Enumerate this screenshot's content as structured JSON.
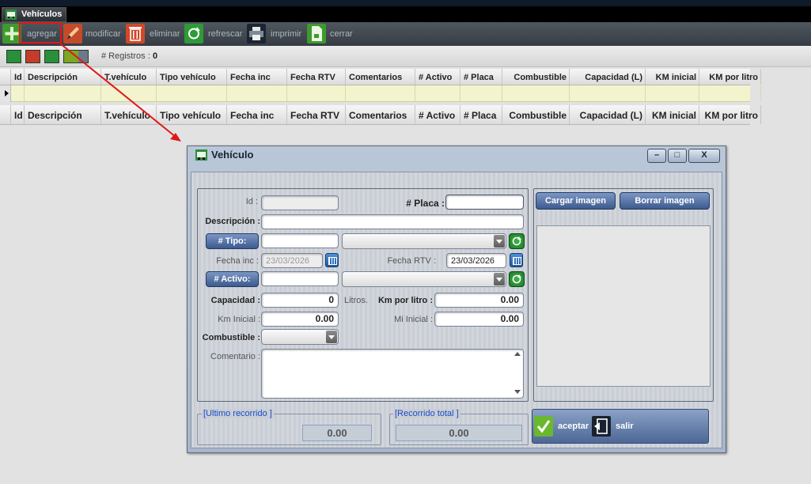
{
  "window": {
    "tab_title": "Vehículos"
  },
  "toolbar": {
    "add": "agregar",
    "modify": "modificar",
    "delete": "eliminar",
    "refresh": "refrescar",
    "print": "imprimir",
    "close": "cerrar"
  },
  "subbar": {
    "records_label": "# Registros :",
    "records_count": "0"
  },
  "grid_columns": [
    "Id",
    "Descripción",
    "T.vehículo",
    "Tipo vehículo",
    "Fecha inc",
    "Fecha RTV",
    "Comentarios",
    "# Activo",
    "# Placa",
    "Combustible",
    "Capacidad (L)",
    "KM inicial",
    "KM por litro"
  ],
  "dialog": {
    "title": "Vehículo",
    "min_btn": "–",
    "max_btn": "□",
    "close_btn": "X",
    "labels": {
      "id": "Id :",
      "placa": "# Placa :",
      "descripcion": "Descripción :",
      "tipo": "# Tipo:",
      "fecha_inc": "Fecha inc :",
      "fecha_rtv": "Fecha RTV :",
      "activo": "# Activo:",
      "capacidad": "Capacidad :",
      "litros": "Litros.",
      "km_por_litro": "Km por litro :",
      "km_inicial": "Km Inicial :",
      "mi_inicial": "Mi Inicial :",
      "combustible": "Combustible :",
      "comentario": "Comentario :"
    },
    "values": {
      "id": "",
      "placa": "",
      "descripcion": "",
      "tipo_code": "",
      "tipo_select": "",
      "fecha_inc": "23/03/2026",
      "fecha_rtv": "23/03/2026",
      "activo_code": "",
      "activo_select": "",
      "capacidad": "0",
      "km_por_litro": "0.00",
      "km_inicial": "0.00",
      "mi_inicial": "0.00",
      "combustible": "",
      "comentario": ""
    },
    "image_buttons": {
      "load": "Cargar imagen",
      "delete": "Borrar imagen"
    },
    "ultimo_recorrido": {
      "legend": "[Ultimo recorrido ]",
      "value": "0.00"
    },
    "recorrido_total": {
      "legend": "[Recorrido total ]",
      "value": "0.00"
    },
    "actions": {
      "accept": "aceptar",
      "exit": "salir"
    }
  },
  "colors": {
    "accent_red": "#e01818",
    "toolbar_bg": "#3f464d",
    "dialog_bg": "#b0bed0",
    "button_blue": "#4e6ea4",
    "green": "#2e9a38"
  }
}
